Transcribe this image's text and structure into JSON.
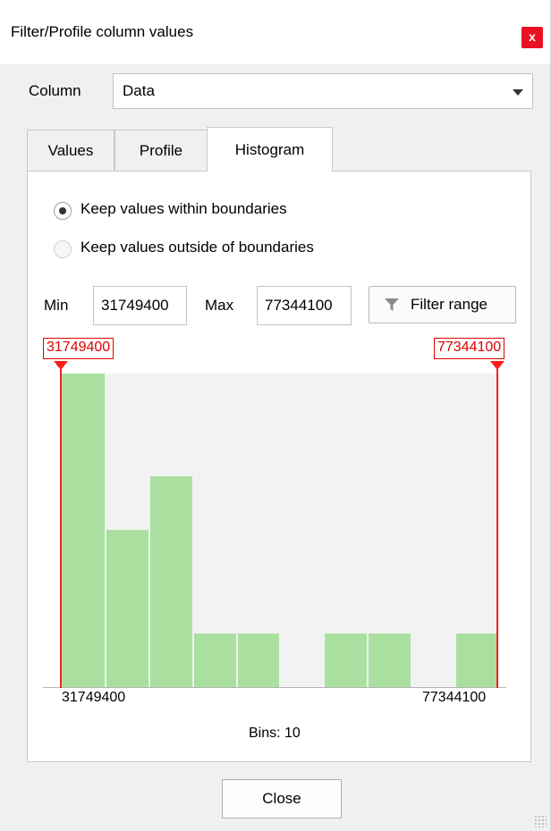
{
  "window": {
    "title": "Filter/Profile column values",
    "close_glyph": "x"
  },
  "column": {
    "label": "Column",
    "value": "Data"
  },
  "tabs": [
    {
      "label": "Values",
      "active": false
    },
    {
      "label": "Profile",
      "active": false
    },
    {
      "label": "Histogram",
      "active": true
    }
  ],
  "mode": {
    "options": [
      {
        "label": "Keep values within boundaries",
        "selected": true
      },
      {
        "label": "Keep values outside of boundaries",
        "selected": false
      }
    ]
  },
  "range": {
    "min_label": "Min",
    "min_value": "31749400",
    "max_label": "Max",
    "max_value": "77344100",
    "filter_button": "Filter range",
    "filter_icon": "funnel-icon"
  },
  "chart_data": {
    "type": "bar",
    "bins_label": "Bins: 10",
    "x_min_label": "31749400",
    "x_max_label": "77344100",
    "lower_boundary": "31749400",
    "upper_boundary": "77344100",
    "values": [
      7,
      3.5,
      4.7,
      1.2,
      1.2,
      0,
      1.2,
      1.2,
      0,
      1.2
    ],
    "bar_color": "#a9e0a0",
    "boundary_color": "#ff2020"
  },
  "footer": {
    "close_label": "Close"
  }
}
